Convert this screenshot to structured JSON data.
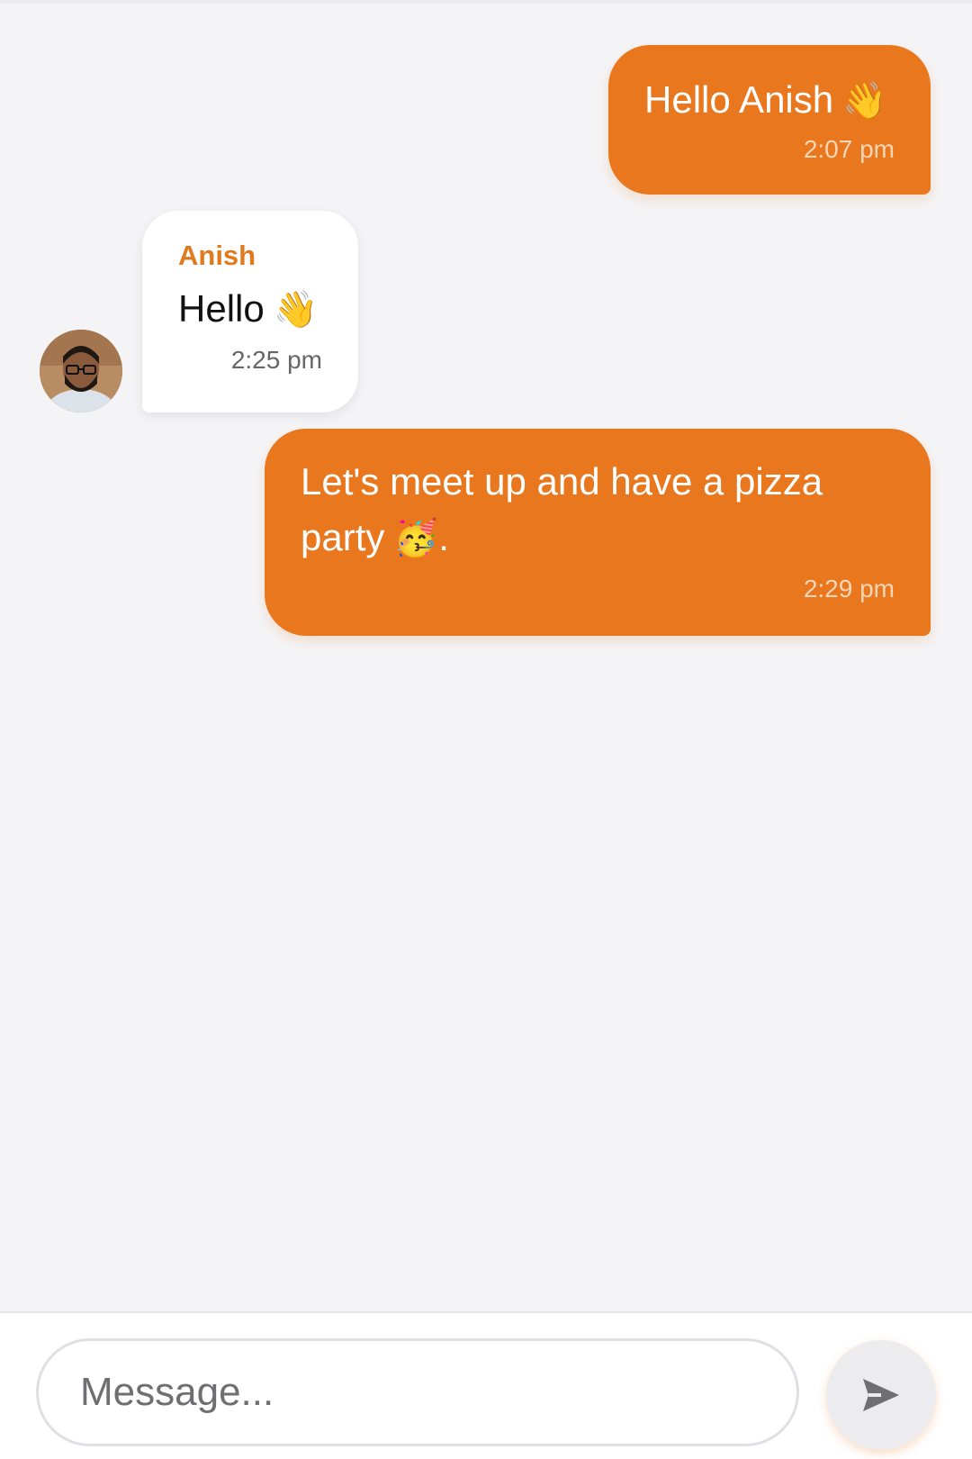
{
  "colors": {
    "accent": "#e8771e",
    "background": "#f4f4f6",
    "incoming_bubble": "#ffffff",
    "sender_name": "#e07a1f"
  },
  "messages": [
    {
      "direction": "outgoing",
      "text": "Hello Anish",
      "emoji": "👋",
      "time": "2:07 pm"
    },
    {
      "direction": "incoming",
      "sender": "Anish",
      "text": "Hello",
      "emoji": "👋",
      "time": "2:25 pm"
    },
    {
      "direction": "outgoing",
      "text_line1": "Let's meet up and have a pizza",
      "text_line2": "party",
      "emoji": "🥳",
      "text_suffix": ".",
      "time": "2:29 pm"
    }
  ],
  "composer": {
    "placeholder": "Message...",
    "value": "",
    "send_icon": "send-arrow-icon"
  },
  "avatar_icon": "user-avatar"
}
